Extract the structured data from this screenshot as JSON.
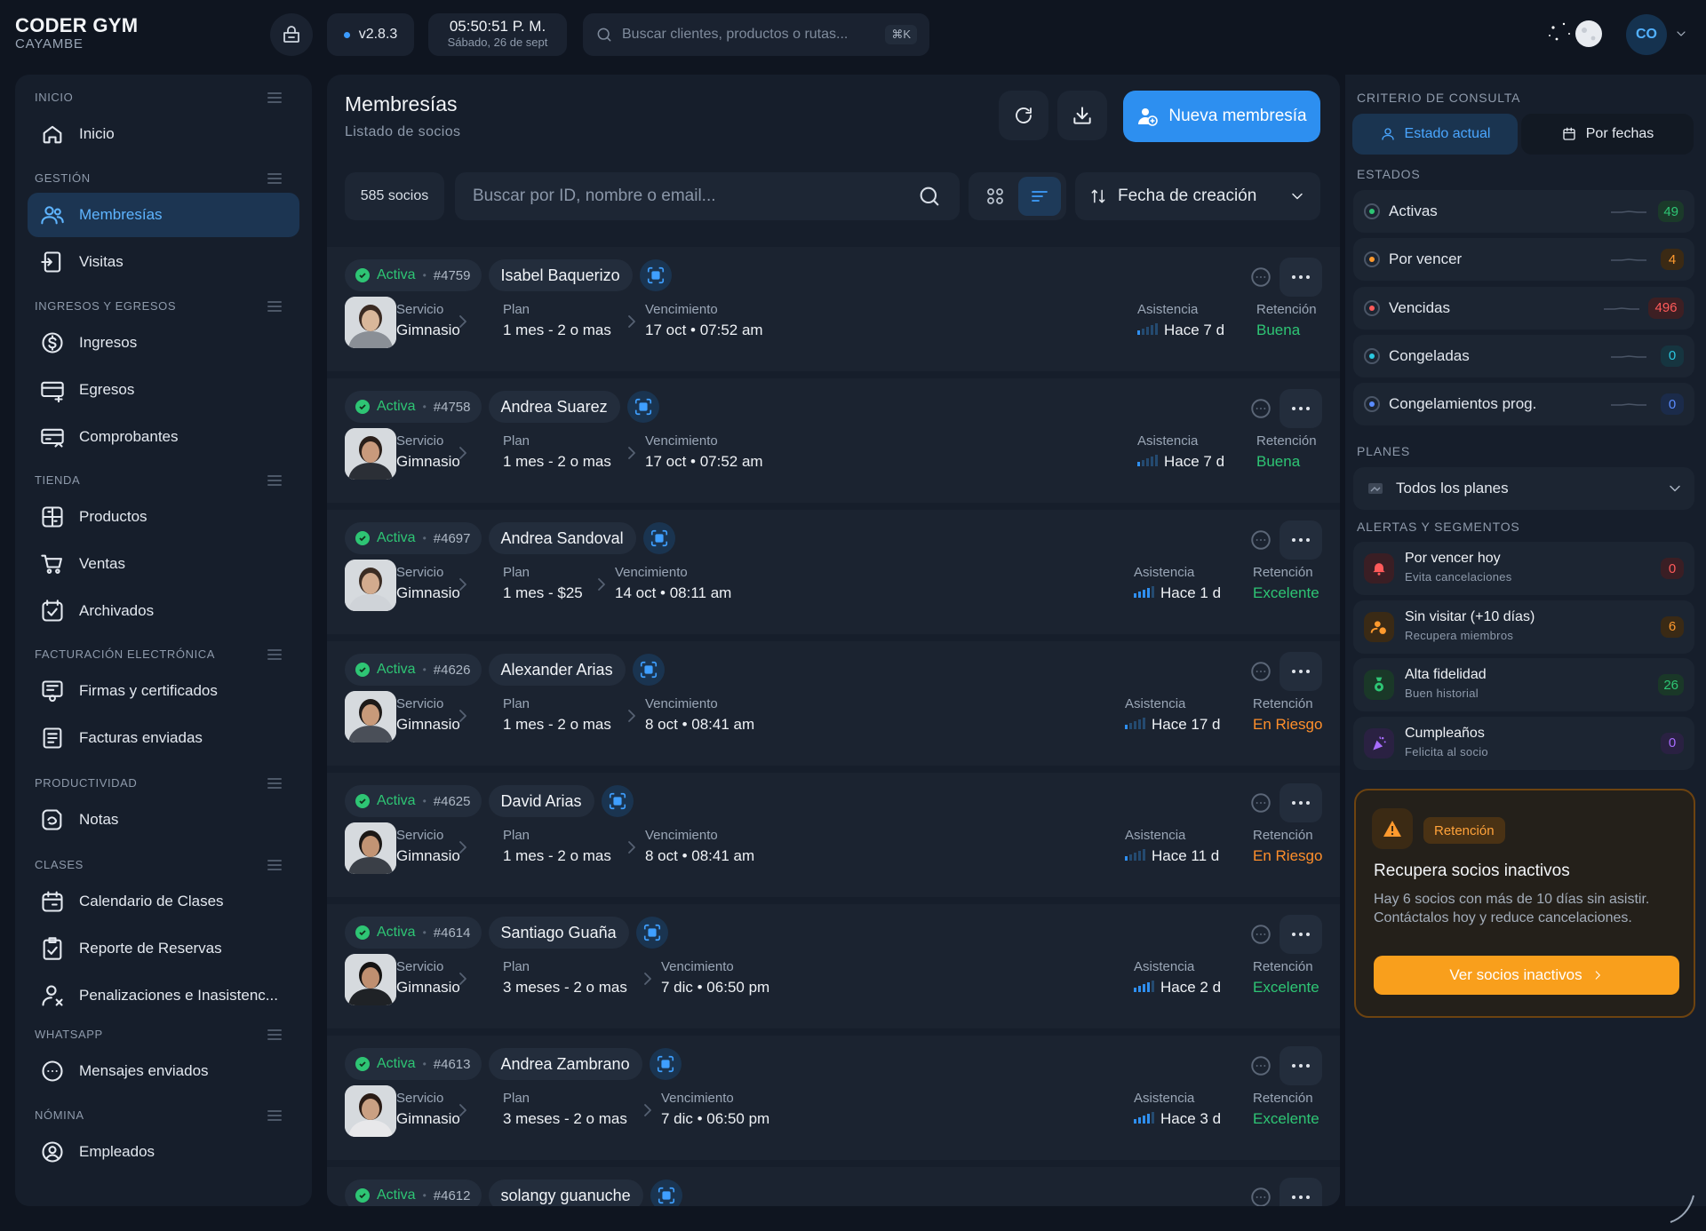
{
  "header": {
    "brand": "CODER GYM",
    "brand_sub": "CAYAMBE",
    "version": "v2.8.3",
    "time": "05:50:51 P. M.",
    "date": "Sábado, 26 de sept",
    "search_placeholder": "Buscar clientes, productos o rutas...",
    "search_shortcut": "⌘K",
    "avatar_initials": "CO"
  },
  "sidebar": {
    "sections": [
      {
        "title": "INICIO",
        "items": [
          {
            "label": "Inicio",
            "icon": "home-icon"
          }
        ]
      },
      {
        "title": "GESTIÓN",
        "items": [
          {
            "label": "Membresías",
            "icon": "users-icon",
            "active": true
          },
          {
            "label": "Visitas",
            "icon": "login-icon"
          }
        ]
      },
      {
        "title": "INGRESOS Y EGRESOS",
        "items": [
          {
            "label": "Ingresos",
            "icon": "dollar-icon"
          },
          {
            "label": "Egresos",
            "icon": "card-out-icon"
          },
          {
            "label": "Comprobantes",
            "icon": "receipt-icon"
          }
        ]
      },
      {
        "title": "TIENDA",
        "items": [
          {
            "label": "Productos",
            "icon": "box-icon"
          },
          {
            "label": "Ventas",
            "icon": "cart-icon"
          },
          {
            "label": "Archivados",
            "icon": "archive-check-icon"
          }
        ]
      },
      {
        "title": "FACTURACIÓN ELECTRÓNICA",
        "items": [
          {
            "label": "Firmas y certificados",
            "icon": "certificate-icon"
          },
          {
            "label": "Facturas enviadas",
            "icon": "invoice-list-icon"
          }
        ]
      },
      {
        "title": "PRODUCTIVIDAD",
        "items": [
          {
            "label": "Notas",
            "icon": "notes-icon"
          }
        ]
      },
      {
        "title": "CLASES",
        "items": [
          {
            "label": "Calendario de Clases",
            "icon": "calendar-icon"
          },
          {
            "label": "Reporte de Reservas",
            "icon": "clipboard-check-icon"
          },
          {
            "label": "Penalizaciones e Inasistenc...",
            "icon": "user-penalty-icon"
          }
        ]
      },
      {
        "title": "WHATSAPP",
        "items": [
          {
            "label": "Mensajes enviados",
            "icon": "chat-icon"
          }
        ]
      },
      {
        "title": "NÓMINA",
        "items": [
          {
            "label": "Empleados",
            "icon": "user-circle-icon"
          }
        ]
      }
    ]
  },
  "main": {
    "title": "Membresías",
    "subtitle": "Listado de socios",
    "new_button": "Nueva membresía",
    "count": "585 socios",
    "search_placeholder": "Buscar por ID, nombre o email...",
    "sort_label": "Fecha de creación",
    "labels": {
      "service": "Servicio",
      "plan": "Plan",
      "expiry": "Vencimiento",
      "attendance": "Asistencia",
      "retention": "Retención"
    },
    "members": [
      {
        "status": "Activa",
        "id": "#4759",
        "name": "Isabel Baquerizo",
        "service": "Gimnasio",
        "plan": "1 mes - 2 o mas",
        "expiry": "17 oct • 07:52 am",
        "attendance": "Hace 7 d",
        "retention": "Buena",
        "level": 1,
        "shirt": "#8a8f96",
        "skin": "#d9b79a",
        "hair": "#3a2a22"
      },
      {
        "status": "Activa",
        "id": "#4758",
        "name": "Andrea Suarez",
        "service": "Gimnasio",
        "plan": "1 mes - 2 o mas",
        "expiry": "17 oct • 07:52 am",
        "attendance": "Hace 7 d",
        "retention": "Buena",
        "level": 1,
        "shirt": "#2b2f36",
        "skin": "#c99a7c",
        "hair": "#2a1f1a"
      },
      {
        "status": "Activa",
        "id": "#4697",
        "name": "Andrea Sandoval",
        "service": "Gimnasio",
        "plan": "1 mes - $25",
        "expiry": "14 oct • 08:11 am",
        "attendance": "Hace 1 d",
        "retention": "Excelente",
        "level": 4,
        "shirt": "#cfd3d8",
        "skin": "#d2ab8e",
        "hair": "#3b2c23"
      },
      {
        "status": "Activa",
        "id": "#4626",
        "name": "Alexander Arias",
        "service": "Gimnasio",
        "plan": "1 mes - 2 o mas",
        "expiry": "8 oct • 08:41 am",
        "attendance": "Hace 17 d",
        "retention": "En Riesgo",
        "level": 1,
        "shirt": "#4a4f58",
        "skin": "#c89a7a",
        "hair": "#1e1a18"
      },
      {
        "status": "Activa",
        "id": "#4625",
        "name": "David Arias",
        "service": "Gimnasio",
        "plan": "1 mes - 2 o mas",
        "expiry": "8 oct • 08:41 am",
        "attendance": "Hace 11 d",
        "retention": "En Riesgo",
        "level": 1,
        "shirt": "#3a3f47",
        "skin": "#c29474",
        "hair": "#1c1816"
      },
      {
        "status": "Activa",
        "id": "#4614",
        "name": "Santiago Guaña",
        "service": "Gimnasio",
        "plan": "3 meses - 2 o mas",
        "expiry": "7 dic • 06:50 pm",
        "attendance": "Hace 2 d",
        "retention": "Excelente",
        "level": 4,
        "shirt": "#1f2226",
        "skin": "#bf8f70",
        "hair": "#151312"
      },
      {
        "status": "Activa",
        "id": "#4613",
        "name": "Andrea Zambrano",
        "service": "Gimnasio",
        "plan": "3 meses - 2 o mas",
        "expiry": "7 dic • 06:50 pm",
        "attendance": "Hace 3 d",
        "retention": "Excelente",
        "level": 4,
        "shirt": "#e8e8ea",
        "skin": "#caa083",
        "hair": "#2a1c16"
      },
      {
        "status": "Activa",
        "id": "#4612",
        "name": "solangy guanuche",
        "service": "",
        "plan": "",
        "expiry": "",
        "attendance": "",
        "retention": "",
        "level": 0,
        "shirt": "#555",
        "skin": "#c9a"
      }
    ]
  },
  "right": {
    "criteria_title": "CRITERIO DE CONSULTA",
    "seg_current": "Estado actual",
    "seg_dates": "Por fechas",
    "states_title": "ESTADOS",
    "states": [
      {
        "label": "Activas",
        "count": "49",
        "color": "#2ec574",
        "bg": "#1b3a2a"
      },
      {
        "label": "Por vencer",
        "count": "4",
        "color": "#ff9a2e",
        "bg": "#3b2a14"
      },
      {
        "label": "Vencidas",
        "count": "496",
        "color": "#ff5a5a",
        "bg": "#3d1f23"
      },
      {
        "label": "Congeladas",
        "count": "0",
        "color": "#2bc8e0",
        "bg": "#163540"
      },
      {
        "label": "Congelamientos prog.",
        "count": "0",
        "color": "#5a8cff",
        "bg": "#1b2b4a"
      }
    ],
    "plans_title": "PLANES",
    "plans_value": "Todos los planes",
    "alerts_title": "ALERTAS Y SEGMENTOS",
    "alerts": [
      {
        "title": "Por vencer hoy",
        "sub": "Evita cancelaciones",
        "count": "0",
        "color": "#ff5a5a",
        "bg": "#3a1e24",
        "icon": "bell-icon"
      },
      {
        "title": "Sin visitar (+10 días)",
        "sub": "Recupera miembros",
        "count": "6",
        "color": "#ff9a2e",
        "bg": "#3a2a15",
        "icon": "user-clock-icon"
      },
      {
        "title": "Alta fidelidad",
        "sub": "Buen historial",
        "count": "26",
        "color": "#2ec574",
        "bg": "#1a3828",
        "icon": "medal-icon"
      },
      {
        "title": "Cumpleaños",
        "sub": "Felicita al socio",
        "count": "0",
        "color": "#a86cff",
        "bg": "#2a2142",
        "icon": "party-icon"
      }
    ],
    "promo": {
      "badge": "Retención",
      "title": "Recupera socios inactivos",
      "text": "Hay 6 socios con más de 10 días sin asistir. Contáctalos hoy y reduce cancelaciones.",
      "button": "Ver socios inactivos"
    }
  }
}
